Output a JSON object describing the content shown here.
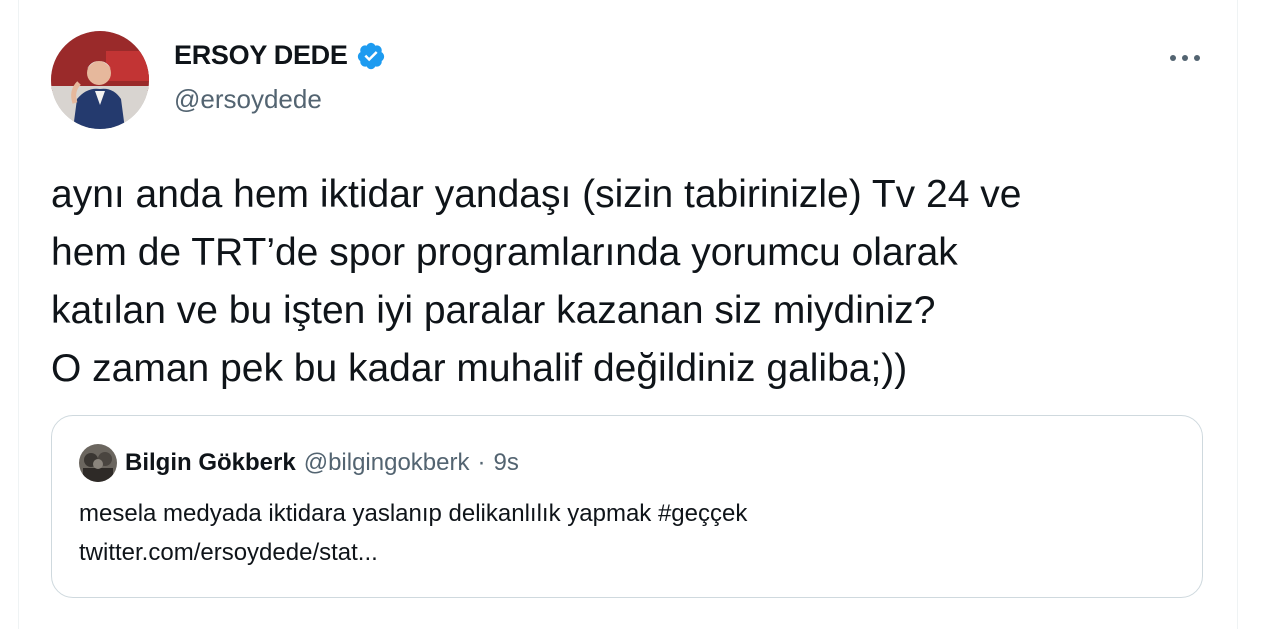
{
  "author": {
    "display_name": "ERSOY DEDE",
    "handle": "@ersoydede",
    "verified": true,
    "avatar_icon": "profile-photo"
  },
  "more_icon": "more-horizontal-icon",
  "tweet": {
    "lines": [
      "aynı anda hem iktidar yandaşı (sizin tabirinizle) Tv 24 ve",
      "hem de TRT’de spor programlarında yorumcu olarak",
      "katılan ve bu işten iyi paralar kazanan siz miydiniz?",
      "O zaman pek bu kadar muhalif değildiniz galiba;))"
    ]
  },
  "quoted_tweet": {
    "display_name": "Bilgin Gökberk",
    "handle": "@bilgingokberk",
    "separator": "·",
    "time": "9s",
    "lines": [
      "mesela medyada iktidara yaslanıp delikanlılık yapmak #geççek",
      "twitter.com/ersoydede/stat..."
    ]
  },
  "colors": {
    "text_primary": "#0f1419",
    "text_secondary": "#536471",
    "verified_blue": "#1d9bf0",
    "card_border": "#cfd9de"
  }
}
